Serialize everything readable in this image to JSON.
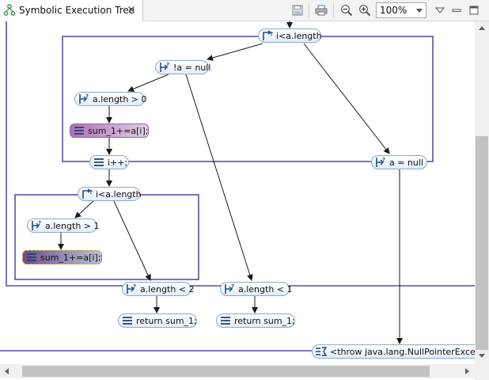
{
  "view": {
    "tab_title": "Symbolic Execution Tree",
    "zoom": "100%"
  },
  "colors": {
    "loop_frame": "#5b4ea8",
    "edge": "#1a1a1a",
    "node_border": "#8fa8c4",
    "highlight": "#b070b4"
  },
  "tree": {
    "nodes": [
      {
        "id": "loop1",
        "label": "i<a.length",
        "kind": "loop-condition",
        "icon": "loop-condition-icon"
      },
      {
        "id": "branch-notnull",
        "label": "!a = null",
        "kind": "branch",
        "icon": "branch-condition-icon"
      },
      {
        "id": "branch-len0",
        "label": "a.length >  0",
        "kind": "branch",
        "icon": "branch-condition-icon"
      },
      {
        "id": "stmt-sum1",
        "label": "sum_1+=a[i];",
        "kind": "statement",
        "icon": "statement-icon"
      },
      {
        "id": "stmt-inc",
        "label": "i++;",
        "kind": "statement",
        "icon": "statement-icon"
      },
      {
        "id": "branch-null",
        "label": "a = null",
        "kind": "branch",
        "icon": "branch-condition-icon"
      },
      {
        "id": "loop2",
        "label": "i<a.length",
        "kind": "loop-condition",
        "icon": "loop-condition-icon"
      },
      {
        "id": "branch-len1",
        "label": "a.length >  1",
        "kind": "branch",
        "icon": "branch-condition-icon"
      },
      {
        "id": "stmt-sum2",
        "label": "sum_1+=a[i];",
        "kind": "statement",
        "icon": "statement-icon"
      },
      {
        "id": "branch-lt2",
        "label": "a.length < 2",
        "kind": "branch",
        "icon": "branch-condition-icon"
      },
      {
        "id": "branch-lt1",
        "label": "a.length < 1",
        "kind": "branch",
        "icon": "branch-condition-icon"
      },
      {
        "id": "ret1",
        "label": "return sum_1;",
        "kind": "statement",
        "icon": "statement-icon"
      },
      {
        "id": "ret2",
        "label": "return sum_1;",
        "kind": "statement",
        "icon": "statement-icon"
      },
      {
        "id": "throw",
        "label": "<throw  java.lang.NullPointerException",
        "kind": "exceptional-termination",
        "icon": "exception-icon"
      }
    ]
  }
}
